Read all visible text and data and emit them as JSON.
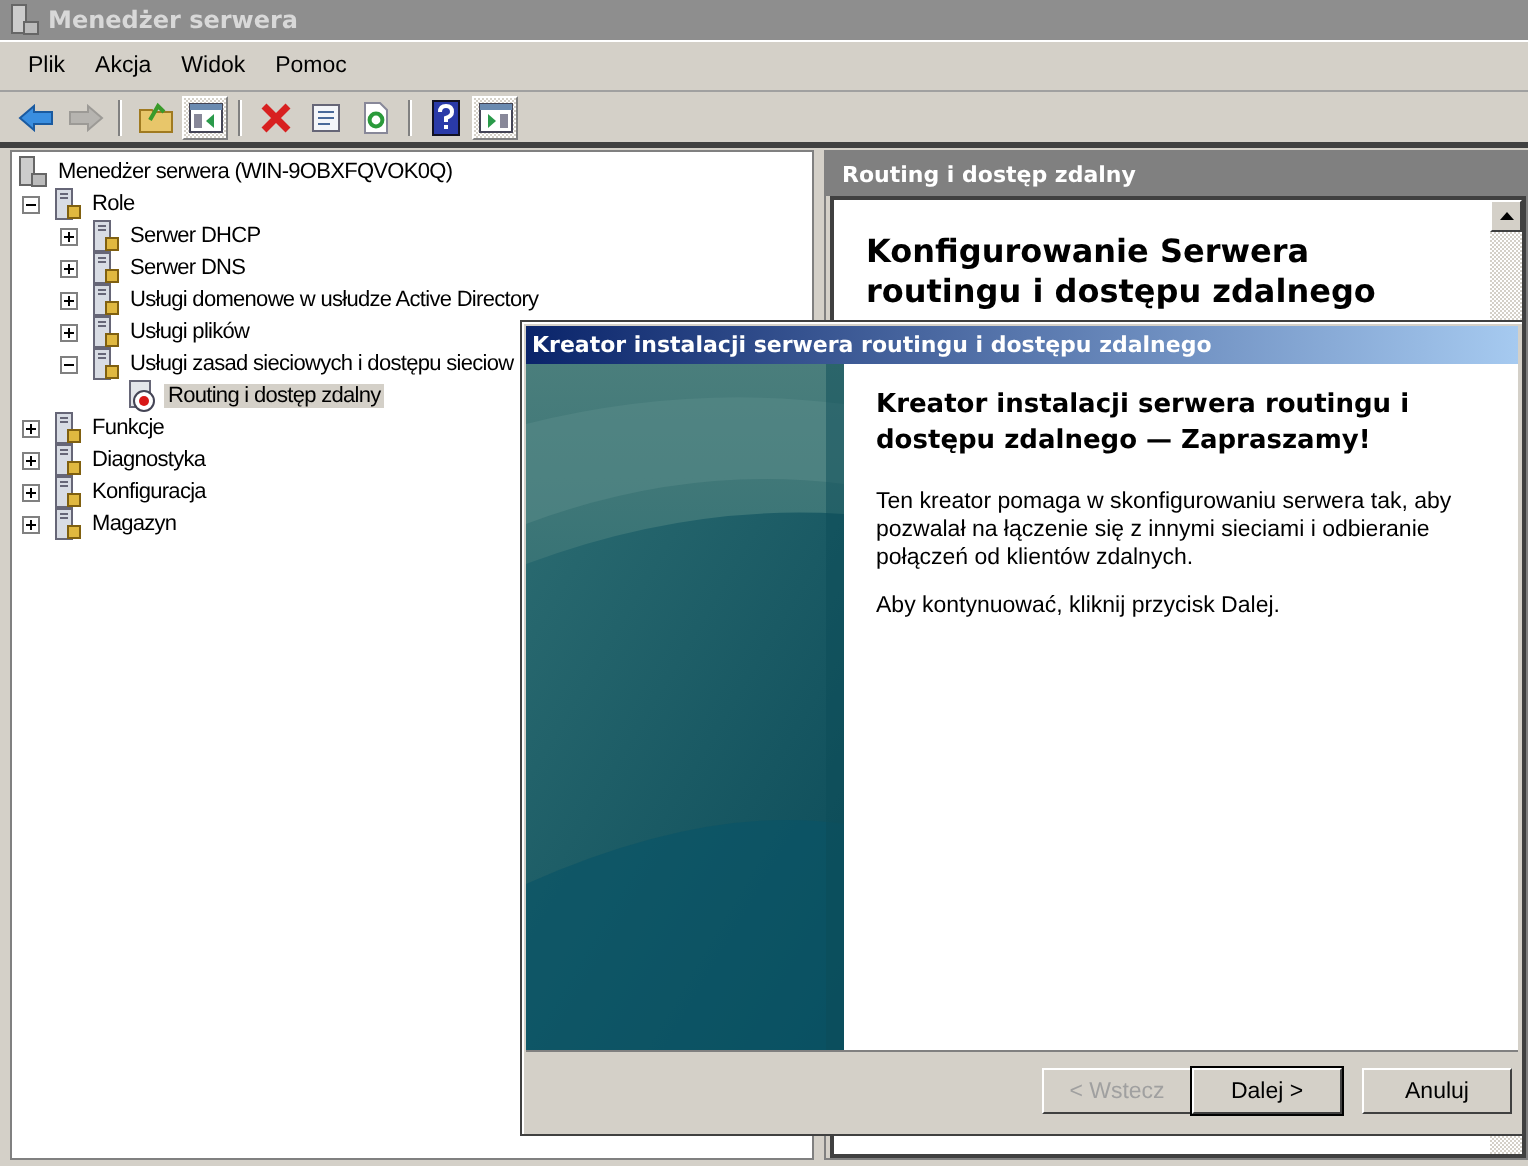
{
  "window": {
    "title": "Menedżer serwera"
  },
  "menu": [
    "Plik",
    "Akcja",
    "Widok",
    "Pomoc"
  ],
  "toolbar": [
    {
      "kind": "back",
      "disabled": false,
      "pressed": false
    },
    {
      "kind": "forward",
      "disabled": true,
      "pressed": false
    },
    {
      "kind": "separator"
    },
    {
      "kind": "up",
      "disabled": false,
      "pressed": false
    },
    {
      "kind": "tree-pane",
      "disabled": false,
      "pressed": true
    },
    {
      "kind": "separator"
    },
    {
      "kind": "delete",
      "disabled": false,
      "pressed": false
    },
    {
      "kind": "properties",
      "disabled": false,
      "pressed": false
    },
    {
      "kind": "refresh",
      "disabled": false,
      "pressed": false
    },
    {
      "kind": "separator"
    },
    {
      "kind": "help",
      "disabled": false,
      "pressed": false
    },
    {
      "kind": "action-pane",
      "disabled": false,
      "pressed": true
    }
  ],
  "tree": {
    "root": {
      "label": "Menedżer serwera (WIN-9OBXFQVOK0Q)",
      "selected": false
    },
    "items": [
      {
        "label": "Role",
        "kind": "server",
        "expanded": true,
        "selected": false,
        "children": [
          {
            "label": "Serwer DHCP",
            "kind": "server",
            "expanded": false,
            "selected": false
          },
          {
            "label": "Serwer DNS",
            "kind": "server",
            "expanded": false,
            "selected": false
          },
          {
            "label": "Usługi domenowe w usłudze Active Directory",
            "kind": "server",
            "expanded": false,
            "selected": false
          },
          {
            "label": "Usługi plików",
            "kind": "server",
            "expanded": false,
            "selected": false
          },
          {
            "label": "Usługi zasad sieciowych i dostępu sieciow",
            "kind": "server",
            "expanded": true,
            "selected": false,
            "children": [
              {
                "label": "Routing i dostęp zdalny",
                "kind": "routing",
                "selected": true
              }
            ]
          }
        ]
      },
      {
        "label": "Funkcje",
        "kind": "server",
        "expanded": false,
        "selected": false
      },
      {
        "label": "Diagnostyka",
        "kind": "server",
        "expanded": false,
        "selected": false
      },
      {
        "label": "Konfiguracja",
        "kind": "server",
        "expanded": false,
        "selected": false
      },
      {
        "label": "Magazyn",
        "kind": "server",
        "expanded": false,
        "selected": false
      }
    ]
  },
  "detail": {
    "header": "Routing i dostęp zdalny",
    "heading": "Konfigurowanie Serwera routingu i dostępu zdalnego"
  },
  "dialog": {
    "title": "Kreator instalacji serwera routingu i dostępu zdalnego",
    "heading": "Kreator instalacji serwera routingu i dostępu zdalnego — Zapraszamy!",
    "paragraphs": [
      "Ten kreator pomaga w skonfigurowaniu serwera tak, aby pozwalał na łączenie się z innymi sieciami i odbieranie połączeń od klientów zdalnych.",
      "Aby kontynuować, kliknij przycisk Dalej."
    ],
    "buttons": [
      {
        "label": "< Wstecz",
        "disabled": true,
        "default": false
      },
      {
        "label": "Dalej >",
        "disabled": false,
        "default": true
      },
      {
        "label": "Anuluj",
        "disabled": false,
        "default": false
      }
    ]
  }
}
